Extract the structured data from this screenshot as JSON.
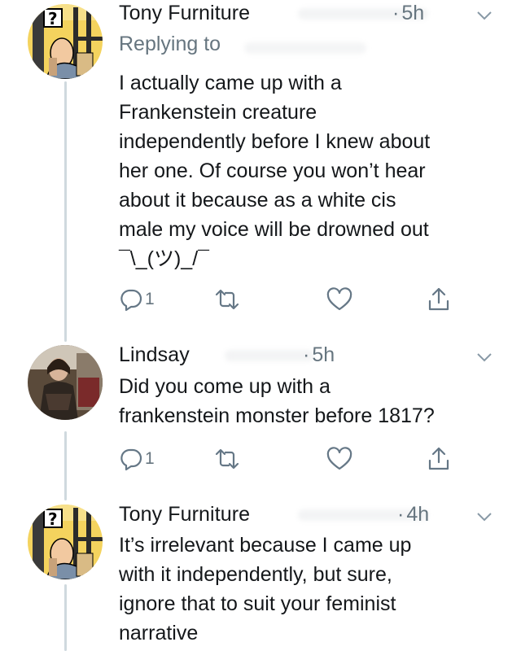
{
  "tweets": [
    {
      "name": "Tony Furniture",
      "time": "5h",
      "replying_label": "Replying to",
      "text": "I actually came up with a\nFrankenstein creature\nindependently before I knew about\nher one. Of course you won’t hear\nabout it because as a white cis\nmale my voice will be drowned out\n¯\\_(ツ)_/¯",
      "reply_count": "1",
      "avatar_icon": "comic-tintin-avatar"
    },
    {
      "name": "Lindsay",
      "time": "5h",
      "text": "Did you come up with a\nfrankenstein monster before 1817?",
      "reply_count": "1",
      "avatar_icon": "photo-avatar"
    },
    {
      "name": "Tony Furniture",
      "time": "4h",
      "text": "It’s irrelevant because I came up\nwith it independently, but sure,\nignore that to suit your feminist\nnarrative",
      "avatar_icon": "comic-tintin-avatar"
    }
  ],
  "colors": {
    "text": "#14171a",
    "muted": "#66757f",
    "thread_line": "#cfd9de",
    "icon": "#657786"
  }
}
